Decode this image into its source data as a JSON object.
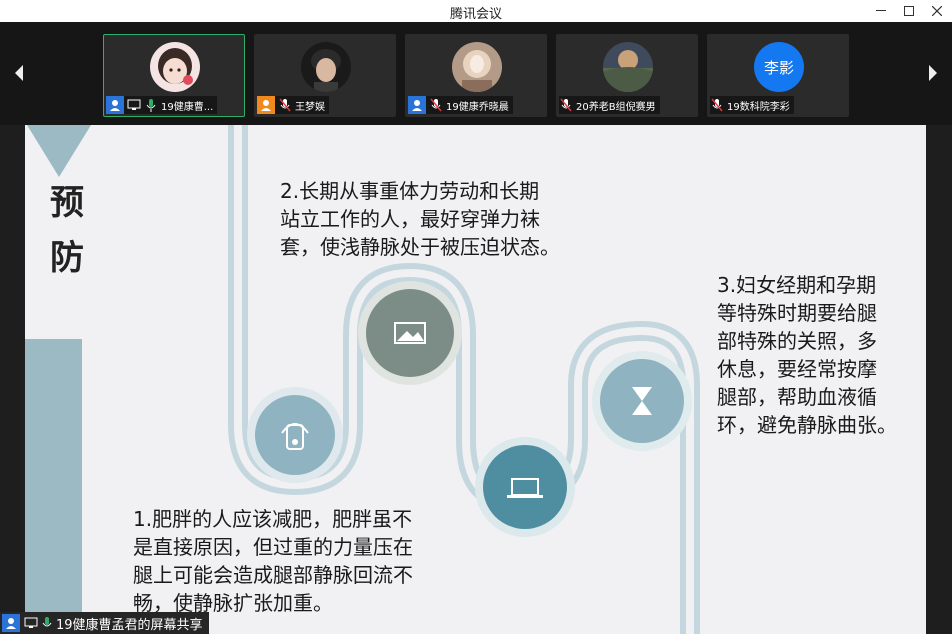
{
  "window": {
    "title": "腾讯会议"
  },
  "participants": [
    {
      "name": "19健康曹...",
      "avatar_type": "photo",
      "badge": "blue",
      "active": true
    },
    {
      "name": "王梦娱",
      "avatar_type": "photo",
      "badge": "orange",
      "active": false
    },
    {
      "name": "19健康乔晓晨",
      "avatar_type": "photo",
      "badge": "blue",
      "active": false
    },
    {
      "name": "20养老B组倪赛男",
      "avatar_type": "photo",
      "badge": "none",
      "active": false
    },
    {
      "name": "19数科院李彩",
      "avatar_type": "initials",
      "avatar_text": "李影",
      "badge": "none",
      "active": false
    }
  ],
  "slide": {
    "heading_lines": [
      "预",
      "防"
    ],
    "point1": [
      "1.肥胖的人应该减肥，肥胖虽不",
      "是直接原因，但过重的力量压在",
      "腿上可能会造成腿部静脉回流不",
      "畅，使静脉扩张加重。"
    ],
    "point2": [
      "2.长期从事重体力劳动和长期",
      "站立工作的人，最好穿弹力袜",
      "套，使浅静脉处于被压迫状态。"
    ],
    "point3": [
      "3.妇女经期和孕期",
      "等特殊时期要给腿",
      "部特殊的关照，多",
      "休息，要经常按摩",
      "腿部，帮助血液循",
      "环，避免静脉曲张。"
    ],
    "icons": [
      "headphones-icon",
      "image-icon",
      "laptop-icon",
      "hourglass-icon"
    ]
  },
  "screen_share": {
    "label": "19健康曹孟君的屏幕共享"
  },
  "colors": {
    "accent_green": "#2fae6a",
    "blue_badge": "#2a73d9",
    "orange_badge": "#f08a1c",
    "slide_teal": "#8fb3c0",
    "circle_dark": "#7b8d86"
  }
}
